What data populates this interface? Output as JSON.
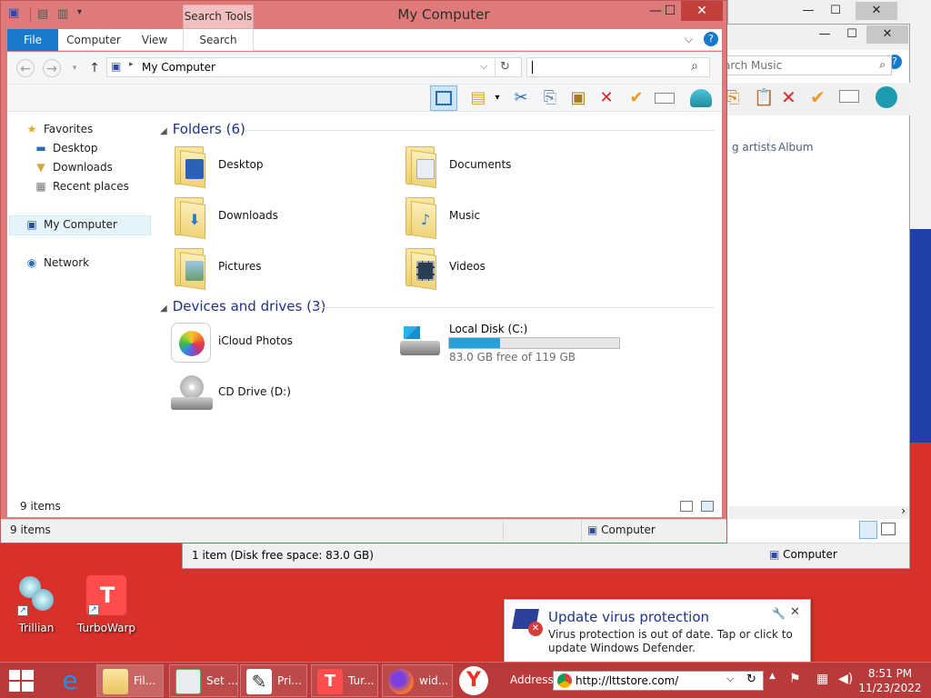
{
  "main_window": {
    "title": "My Computer",
    "context_tab": "Search Tools",
    "ribbon_tabs": [
      "File",
      "Computer",
      "View",
      "Search"
    ],
    "address_path": "My Computer",
    "search_value": "",
    "nav": {
      "favorites": "Favorites",
      "desktop": "Desktop",
      "downloads": "Downloads",
      "recent_places": "Recent places",
      "my_computer": "My Computer",
      "network": "Network"
    },
    "folders_group": "Folders (6)",
    "folders": [
      "Desktop",
      "Documents",
      "Downloads",
      "Music",
      "Pictures",
      "Videos"
    ],
    "devices_group": "Devices and drives (3)",
    "devices": {
      "icloud": "iCloud Photos",
      "local_disk": "Local Disk (C:)",
      "local_disk_free": "83.0 GB free of 119 GB",
      "local_disk_used_fraction": 0.3,
      "cd_drive": "CD Drive (D:)"
    },
    "status_inner": "9 items",
    "status_outer": "9 items",
    "status_location": "Computer"
  },
  "bg_window": {
    "search_placeholder": "arch Music",
    "col_artists": "g artists",
    "col_album": "Album",
    "status_text": "1 item (Disk free space: 83.0 GB)",
    "status_location": "Computer"
  },
  "desktop_icons": {
    "trillian": "Trillian",
    "turbowarp": "TurboWarp"
  },
  "toast": {
    "title": "Update virus protection",
    "body": "Virus protection is out of date. Tap or click to update Windows Defender."
  },
  "taskbar": {
    "items": [
      "Fil...",
      "Set ...",
      "Pri...",
      "Tur...",
      "wid..."
    ],
    "address_label": "Address",
    "address_url": "http://lttstore.com/",
    "time": "8:51 PM",
    "date": "11/23/2022"
  },
  "colors": {
    "desktop": "#d8302a",
    "window_frame": "#de7a7a",
    "taskbar": "#b93a3a",
    "file_tab": "#1979ca",
    "group_title": "#1e3287",
    "progress_fill": "#26a0da"
  }
}
